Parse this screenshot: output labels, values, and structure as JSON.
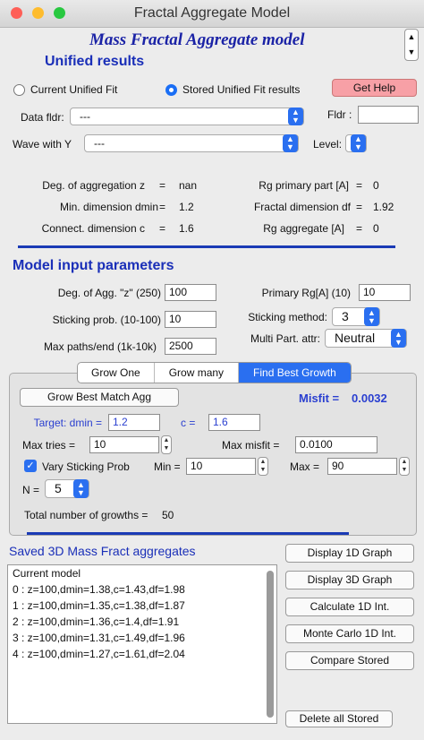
{
  "window": {
    "title": "Fractal Aggregate Model"
  },
  "panel_title": "Mass Fractal Aggregate model",
  "unified": {
    "heading": "Unified results",
    "radio_current": "Current Unified Fit",
    "radio_stored": "Stored Unified Fit results",
    "get_help": "Get Help",
    "data_fldr_label": "Data fldr:",
    "data_fldr_value": "---",
    "fldr_label": "Fldr :",
    "fldr_value": "",
    "wave_label": "Wave with Y",
    "wave_value": "---",
    "level_label": "Level:",
    "results": {
      "deg_agg_label": "Deg. of aggregation z",
      "deg_agg_eq": "=",
      "deg_agg_value": "nan",
      "dmin_label": "Min. dimension  dmin",
      "dmin_eq": "=",
      "dmin_value": "1.2",
      "conn_label": "Connect. dimension c",
      "conn_eq": "=",
      "conn_value": "1.6",
      "rg_prim_label": "Rg primary part [A]",
      "rg_prim_eq": "=",
      "rg_prim_value": "0",
      "df_label": "Fractal dimension df",
      "df_eq": "=",
      "df_value": "1.92",
      "rg_agg_label": "Rg aggregate [A]",
      "rg_agg_eq": "=",
      "rg_agg_value": "0"
    }
  },
  "model": {
    "heading": "Model input parameters",
    "deg_agg_label": "Deg. of Agg. \"z\" (250)",
    "deg_agg_value": "100",
    "sticking_label": "Sticking prob. (10-100)",
    "sticking_value": "10",
    "maxpaths_label": "Max paths/end (1k-10k)",
    "maxpaths_value": "2500",
    "primary_rg_label": "Primary Rg[A] (10)",
    "primary_rg_value": "10",
    "sticking_method_label": "Sticking method:",
    "sticking_method_value": "3",
    "multi_part_label": "Multi Part. attr:",
    "multi_part_value": "Neutral"
  },
  "tabs": [
    "Grow One",
    "Grow many",
    "Find Best Growth"
  ],
  "growth": {
    "grow_best_button": "Grow Best Match Agg",
    "misfit_label": "Misfit =",
    "misfit_value": "0.0032",
    "target_label": "Target: dmin =",
    "target_dmin": "1.2",
    "c_label": "c =",
    "c_value": "1.6",
    "max_tries_label": "Max tries =",
    "max_tries_value": "10",
    "max_misfit_label": "Max misfit =",
    "max_misfit_value": "0.0100",
    "vary_label": "Vary Sticking Prob",
    "min_label": "Min =",
    "min_value": "10",
    "max_label": "Max =",
    "max_value": "90",
    "n_label": "N =",
    "n_value": "5",
    "total_label": "Total number of growths =",
    "total_value": "50"
  },
  "saved": {
    "heading": "Saved 3D Mass Fract aggregates",
    "items": [
      "Current model",
      "0 : z=100,dmin=1.38,c=1.43,df=1.98",
      "1 : z=100,dmin=1.35,c=1.38,df=1.87",
      "2 : z=100,dmin=1.36,c=1.4,df=1.91",
      "3 : z=100,dmin=1.31,c=1.49,df=1.96",
      "4 : z=100,dmin=1.27,c=1.61,df=2.04"
    ]
  },
  "actions": {
    "display_1d": "Display 1D Graph",
    "display_3d": "Display 3D Graph",
    "calc_1d": "Calculate 1D Int.",
    "monte_carlo": "Monte Carlo 1D Int.",
    "compare": "Compare Stored",
    "delete_all": "Delete all Stored"
  },
  "colors": {
    "accent": "#2a6ff0",
    "heading_blue": "#1a2fb8",
    "help_button": "#f7a0a6",
    "misfit_blue": "#2a3fd0"
  }
}
